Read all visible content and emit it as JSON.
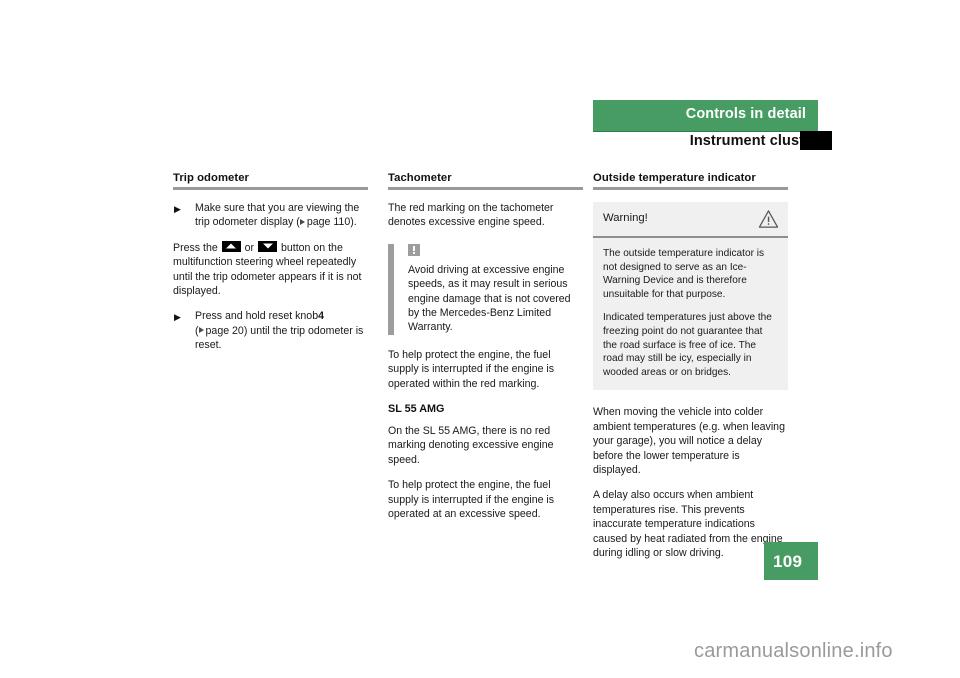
{
  "header": {
    "band_title": "Controls in detail",
    "subtitle": "Instrument cluster"
  },
  "columns": {
    "trip_odometer": {
      "title": "Trip odometer",
      "bullet_1_text": "Make sure that you are viewing the trip odometer display (",
      "bullet_1_pageref": "page 110).",
      "paragraph_pre": "Press the",
      "paragraph_or": "or",
      "paragraph_post": "button on the multifunction steering wheel repeatedly until the trip odometer appears if it is not displayed.",
      "bullet_2_pre": "Press and hold reset knob",
      "bullet_2_bold": "4",
      "bullet_2_pageref": "page 20)",
      "bullet_2_post": " until the trip odometer is reset."
    },
    "tachometer": {
      "title": "Tachometer",
      "intro": "The red marking on the tachometer denotes excessive engine speed.",
      "note": "Avoid driving at excessive engine speeds, as it may result in serious engine damage that is not covered by the Mercedes-Benz Limited Warranty.",
      "after_note": "To help protect the engine, the fuel supply is interrupted if the engine is operated within the red marking.",
      "subhead": "SL 55 AMG",
      "amg_p1": "On the SL 55 AMG, there is no red marking denoting excessive engine speed.",
      "amg_p2": "To help protect the engine, the fuel supply is interrupted if the engine is operated at an excessive speed."
    },
    "outside_temperature": {
      "title": "Outside temperature indicator",
      "warning_label": "Warning!",
      "warning_p1": "The outside temperature indicator is not designed to serve as an Ice-Warning Device and is therefore unsuitable for that purpose.",
      "warning_p2": "Indicated temperatures just above the freezing point do not guarantee that the road surface is free of ice. The road may still be icy, especially in wooded areas or on bridges.",
      "body_p1": "When moving the vehicle into colder ambient temperatures (e.g. when leaving your garage), you will notice a delay before the lower temperature is displayed.",
      "body_p2": "A delay also occurs when ambient temperatures rise. This prevents inaccurate temperature indications caused by heat radiated from the engine during idling or slow driving."
    }
  },
  "footer": {
    "page_number": "109",
    "watermark": "carmanualsonline.info"
  },
  "icons": {
    "bullet_marker": "▶",
    "button_up": "up-triangle-button",
    "button_down": "down-triangle-button",
    "note_icon": "exclamation-square-icon",
    "warning_icon": "warning-triangle-icon",
    "page_ref_arrow": "right-triangle-icon"
  },
  "colors": {
    "brand_green": "#469c62",
    "rule_gray": "#9a9a9a",
    "warn_bg": "#f0f0f0",
    "text": "#1a1a1a"
  }
}
